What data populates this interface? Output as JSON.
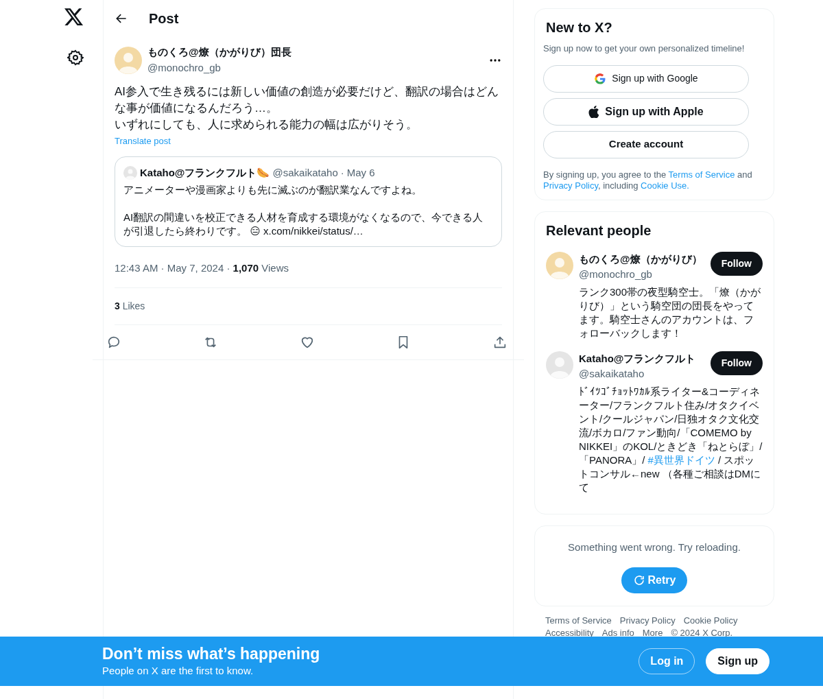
{
  "header": {
    "title": "Post"
  },
  "post": {
    "author": {
      "name": "ものくろ@燎（かがりび）団長",
      "handle": "@monochro_gb"
    },
    "paragraphs": [
      "AI参入で生き残るには新しい価値の創造が必要だけど、翻訳の場合はどんな事が価値になるんだろう…。",
      "いずれにしても、人に求められる能力の幅は広がりそう。"
    ],
    "translate": "Translate post",
    "quote": {
      "name": "Kataho@フランクフルト🌭",
      "handle": "@sakaikataho",
      "separator": "·",
      "date": "May 6",
      "text": "アニメーターや漫画家よりも先に滅ぶのが翻訳業なんですよね。\n\nAI翻訳の間違いを校正できる人材を育成する環境がなくなるので、今できる人が引退したら終わりです。 😑",
      "link": "x.com/nikkei/status/…"
    },
    "meta": "12:43 AM · May 7, 2024 · **1,070** Views",
    "likes": "**3** Likes"
  },
  "signup": {
    "title": "New to X?",
    "subtitle": "Sign up now to get your own personalized timeline!",
    "buttons": [
      {
        "label": "Sign up with Google",
        "kind": "google"
      },
      {
        "label": "Sign up with Apple",
        "kind": "apple"
      },
      {
        "label": "Create account",
        "kind": "plain"
      }
    ],
    "terms": [
      {
        "text": "By signing up, you agree to the "
      },
      {
        "text": "Terms of Service",
        "kind": "link"
      },
      {
        "text": " and "
      },
      {
        "text": "Privacy Policy",
        "kind": "link"
      },
      {
        "text": ", including "
      },
      {
        "text": "Cookie Use.",
        "kind": "link"
      }
    ]
  },
  "relevant": {
    "title": "Relevant people",
    "people": [
      {
        "name": "ものくろ@燎（かがりび）",
        "handle": "@monochro_gb",
        "button": "Follow",
        "bio": [
          {
            "text": "ランク300帯の夜型騎空士。「燎（かがりび）」という騎空団の団長をやってます。騎空士さんのアカウントは、フォローバックします！"
          }
        ]
      },
      {
        "name": "Kataho@フランクフルト",
        "handle": "@sakaikataho",
        "button": "Follow",
        "bio": [
          {
            "text": "ﾄﾞｲﾂｺﾞﾁｮｯﾄﾜｶﾙ系ライター&コーディネーター/フランクフルト住み/オタクイベント/クールジャパン/日独オタク文化交流/ボカロ/ファン動向/「COMEMO by NIKKEI」のKOL/ときどき「ねとらぼ」/「PANORA」/ "
          },
          {
            "text": "#異世界ドイツ",
            "kind": "hashtag"
          },
          {
            "text": " / スポットコンサル←new （各種ご相談はDMにて"
          }
        ]
      }
    ]
  },
  "error": {
    "message": "Something went wrong. Try reloading.",
    "button": "Retry"
  },
  "footer": {
    "links": [
      "Terms of Service",
      "Privacy Policy",
      "Cookie Policy",
      "Accessibility",
      "Ads info",
      "More",
      "© 2024 X Corp."
    ]
  },
  "banner": {
    "title": "Don’t miss what’s happening",
    "subtitle": "People on X are the first to know.",
    "buttons": [
      {
        "label": "Log in",
        "kind": "outline"
      },
      {
        "label": "Sign up",
        "kind": "solid"
      }
    ]
  }
}
